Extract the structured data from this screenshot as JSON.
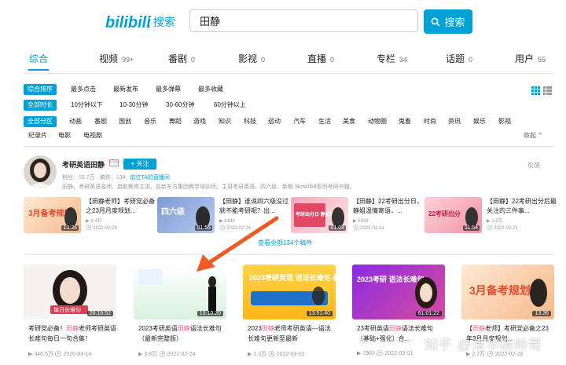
{
  "header": {
    "logo_text": "bilibili",
    "section": "搜索",
    "search_value": "田静",
    "search_button": "搜索"
  },
  "tabs": [
    {
      "label": "综合",
      "count": ""
    },
    {
      "label": "视频",
      "count": "99+"
    },
    {
      "label": "番剧",
      "count": "0"
    },
    {
      "label": "影视",
      "count": "0"
    },
    {
      "label": "直播",
      "count": "0"
    },
    {
      "label": "专栏",
      "count": "34"
    },
    {
      "label": "话题",
      "count": "0"
    },
    {
      "label": "用户",
      "count": "55"
    }
  ],
  "filters": {
    "sort": {
      "label": "综合排序",
      "options": [
        "最多点击",
        "最新发布",
        "最多弹幕",
        "最多收藏"
      ]
    },
    "duration": {
      "label": "全部时长",
      "options": [
        "10分钟以下",
        "10-30分钟",
        "30-60分钟",
        "60分钟以上"
      ]
    },
    "zone": {
      "label": "全部分区",
      "options": [
        "动画",
        "番剧",
        "国创",
        "音乐",
        "舞蹈",
        "游戏",
        "知识",
        "科技",
        "运动",
        "汽车",
        "生活",
        "美食",
        "动物圈",
        "鬼畜",
        "时尚",
        "资讯",
        "娱乐",
        "影视"
      ]
    },
    "zone2": [
      "纪录片",
      "电影",
      "电视剧"
    ],
    "fold": "收起"
  },
  "user_card": {
    "name": "考研英语田静",
    "level": "LV6",
    "follow_label": "+ 关注",
    "feedback": "反馈",
    "stats": "粉丝：55.7万 · 稿件：134",
    "live_link": "前往TA的直播间",
    "desc": "田静，考研英语名师、启航教育主讲，前新东方集团教学培训师。主讲考研英语、四六级、新概 9kmkl8i8系列考研书籍。",
    "view_all": "查看全部134个稿件",
    "mini_videos": [
      {
        "title": "【田静老师】考研党必备之23月月度规划...",
        "views": "3.4万",
        "date": "2022-02-28",
        "duration": "13:36",
        "thumb_text": "3月备考规划"
      },
      {
        "title": "【田静】谁说四六级没过就不能考研呢？出...",
        "views": "8198",
        "date": "2022-02-24",
        "duration": "01:55",
        "thumb_text": "四六级"
      },
      {
        "title": "【田静】22考研出分日，静姐温情寄语，...",
        "views": "5999",
        "date": "2022-02-21",
        "duration": "01:09",
        "thumb_text": "考研出分日 静姐寄语"
      },
      {
        "title": "【田静】22考研出分后最关注的三件事...",
        "views": "2.6万",
        "date": "2022-02-21",
        "duration": "11:54",
        "thumb_text": "22考研出分"
      }
    ]
  },
  "videos": [
    {
      "title_pre": "考研党必备！",
      "title_hl": "田静",
      "title_post": "老师考研英语长难句每日一句合集！",
      "views": "340.5万",
      "date": "2020-04-14",
      "duration": "26:16:52",
      "thumb_text": "每日长难句"
    },
    {
      "title_pre": "2023考研英语",
      "title_hl": "田静",
      "title_post": "语法长难句（最新完整版）",
      "views": "3.8万",
      "date": "2022-02-24",
      "duration": "13:10:20",
      "thumb_text": ""
    },
    {
      "title_pre": "2023",
      "title_hl": "田静",
      "title_post": "老师考研英语—语法长难句更新至最新",
      "views": "1.3万",
      "date": "2022-03-01",
      "duration": "13:51:40",
      "thumb_text": "2023考研英语 语法长难句-最新"
    },
    {
      "title_pre": "23考研英语",
      "title_hl": "田静",
      "title_post": "语法长难句（基础+强化）合...",
      "views": "2965",
      "date": "2022-03-01",
      "duration": "61:01:22",
      "thumb_text": "2023考研 语法长难句"
    },
    {
      "title_pre": "【",
      "title_hl": "田静",
      "title_post": "老师】考研党必备之23年3月月度规划...",
      "views": "2.7万",
      "date": "2022-02-28",
      "duration": "13:36",
      "thumb_text": "3月备考规划"
    }
  ],
  "watermark": "知乎 @清华杨帅哥"
}
